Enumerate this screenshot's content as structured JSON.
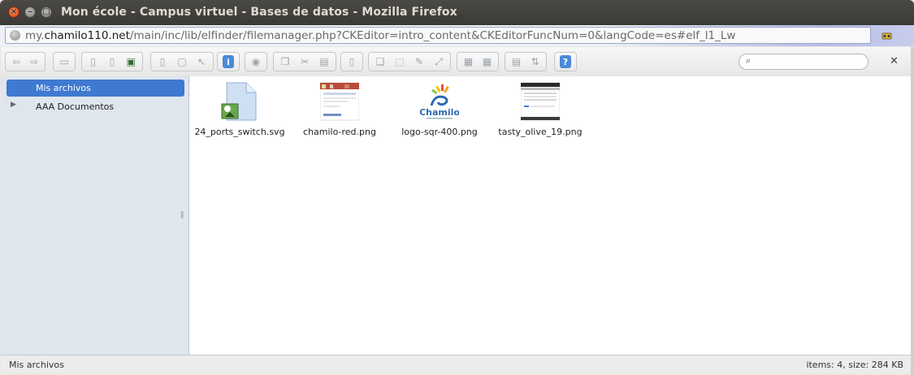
{
  "window": {
    "title": "Mon école - Campus virtuel - Bases de datos - Mozilla Firefox"
  },
  "urlbar": {
    "prefix": "my.",
    "domain": "chamilo110.net",
    "path": "/main/inc/lib/elfinder/filemanager.php?CKEditor=intro_content&CKEditorFuncNum=0&langCode=es#elf_l1_Lw"
  },
  "toolbar": {
    "search_value": ""
  },
  "sidebar": {
    "items": [
      {
        "label": "Mis archivos",
        "selected": true
      },
      {
        "label": "AAA Documentos",
        "selected": false
      }
    ]
  },
  "files": [
    {
      "name": "24_ports_switch.svg",
      "icon": "svg-file-icon"
    },
    {
      "name": "chamilo-red.png",
      "icon": "screenshot-thumbnail"
    },
    {
      "name": "logo-sqr-400.png",
      "icon": "chamilo-logo-thumbnail"
    },
    {
      "name": "tasty_olive_19.png",
      "icon": "screenshot-thumbnail"
    }
  ],
  "status": {
    "path": "Mis archivos",
    "summary": "items: 4, size: 284 KB"
  },
  "colors": {
    "selection": "#3f79d0",
    "sidebar_bg": "#dfe6ee",
    "titlebar": "#3c3b37"
  }
}
